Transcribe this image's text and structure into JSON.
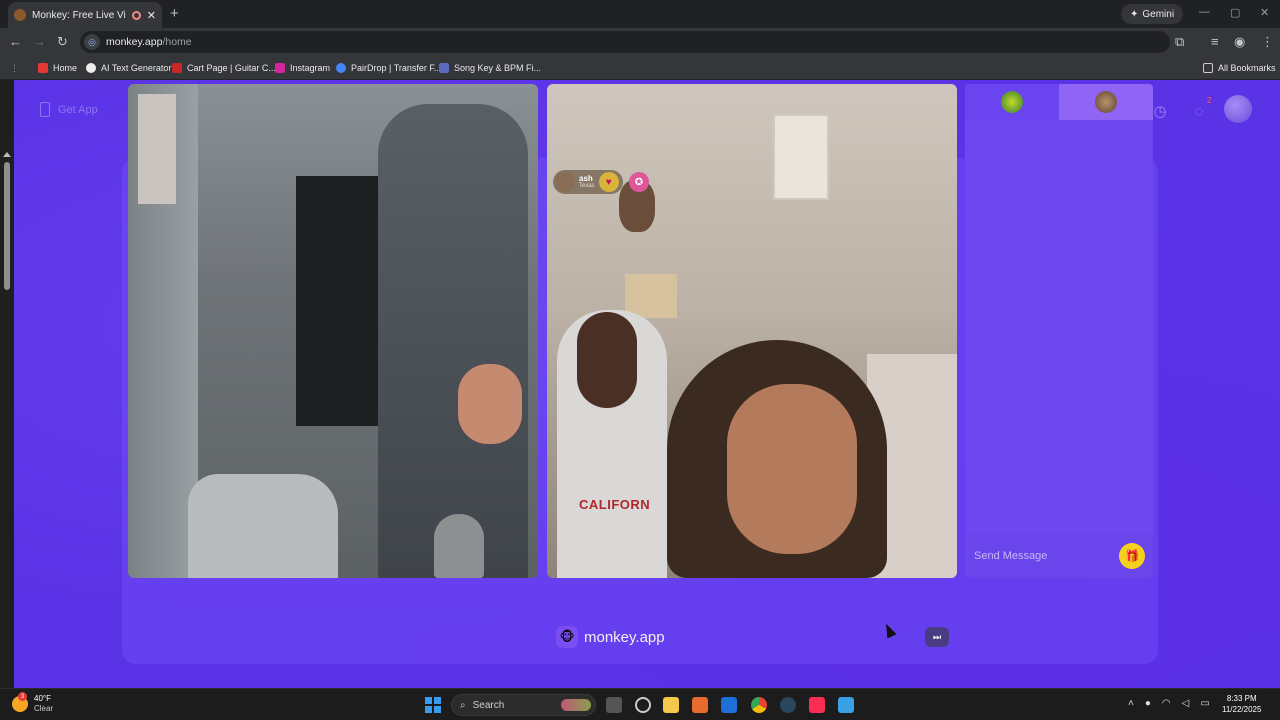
{
  "browser": {
    "tab_title": "Monkey: Free Live Video Ch",
    "tab_close": "✕",
    "new_tab": "+",
    "gemini_label": "Gemini",
    "url_host": "monkey.app",
    "url_path": "/home",
    "bookmarks": [
      "Home",
      "AI Text Generator",
      "Cart Page | Guitar C...",
      "Instagram",
      "PairDrop | Transfer F...",
      "Song Key & BPM Fi..."
    ],
    "all_bookmarks": "All Bookmarks",
    "colors": {
      "chrome_dark": "#202124",
      "chrome_light": "#35363a"
    }
  },
  "page": {
    "get_app_label": "Get App",
    "message_badge": "2",
    "colors": {
      "background": "#5b33e6",
      "chat_panel": "#6f47f0",
      "gift": "#f4d21b"
    }
  },
  "video": {
    "partner_name": "ash",
    "partner_location": "Texas",
    "shirt_text": "CALIFORN",
    "watermark": "monkey.app"
  },
  "chat": {
    "placeholder": "Send Message"
  },
  "taskbar": {
    "temperature": "40°F",
    "condition": "Clear",
    "weather_badge": "3",
    "search_label": "Search",
    "time": "8:33 PM",
    "date": "11/22/2025"
  },
  "icons": [
    "search-icon",
    "crown-icon",
    "history-icon",
    "chat-icon",
    "gift-icon",
    "skip-icon",
    "phone-icon",
    "star-icon",
    "reload-icon"
  ]
}
